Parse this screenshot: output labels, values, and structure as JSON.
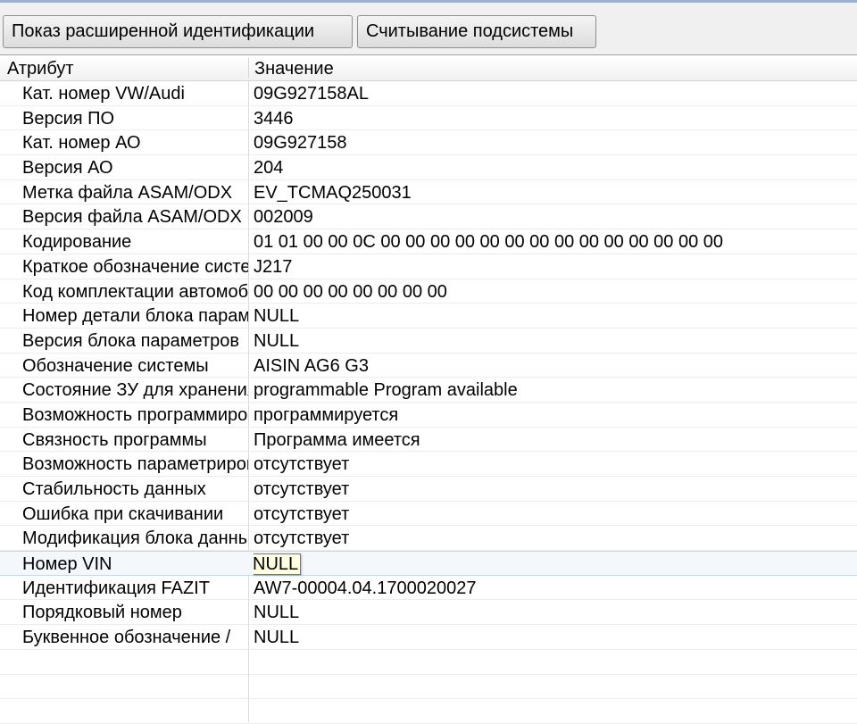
{
  "toolbar": {
    "extended_id_label": "Показ расширенной идентификации",
    "read_subsystem_label": "Считывание подсистемы"
  },
  "table": {
    "columns": [
      "Атрибут",
      "Значение"
    ],
    "rows": [
      {
        "attr": "Кат. номер VW/Audi",
        "value": "09G927158AL"
      },
      {
        "attr": "Версия ПО",
        "value": "3446"
      },
      {
        "attr": "Кат. номер АО",
        "value": "09G927158"
      },
      {
        "attr": "Версия АО",
        "value": "204"
      },
      {
        "attr": "Метка файла ASAM/ODX",
        "value": "EV_TCMAQ250031"
      },
      {
        "attr": "Версия файла ASAM/ODX",
        "value": "002009"
      },
      {
        "attr": "Кодирование",
        "value": "01 01 00 00 0C 00 00 00 00 00 00 00 00 00 00 00 00 00 00"
      },
      {
        "attr": "Краткое обозначение системы",
        "value": "J217"
      },
      {
        "attr": "Код комплектации автомобиля",
        "value": "00 00 00 00 00 00 00 00"
      },
      {
        "attr": "Номер детали блока параметров",
        "value": "NULL"
      },
      {
        "attr": "Версия блока параметров",
        "value": "NULL"
      },
      {
        "attr": "Обозначение системы",
        "value": "AISIN AG6 G3"
      },
      {
        "attr": "Состояние ЗУ для хранения",
        "value": "programmable Program available"
      },
      {
        "attr": "Возможность программирования",
        "value": "программируется"
      },
      {
        "attr": "Связность программы",
        "value": "Программа имеется"
      },
      {
        "attr": "Возможность параметрирования",
        "value": "отсутствует"
      },
      {
        "attr": "Стабильность данных",
        "value": "отсутствует"
      },
      {
        "attr": "Ошибка при скачивании",
        "value": "отсутствует"
      },
      {
        "attr": "Модификация блока данных",
        "value": "отсутствует"
      },
      {
        "attr": "Номер VIN",
        "value": "NULL"
      },
      {
        "attr": "Идентификация FAZIT",
        "value": "AW7-00004.04.1700020027"
      },
      {
        "attr": "Порядковый номер",
        "value": "NULL"
      },
      {
        "attr": "Буквенное обозначение /",
        "value": "NULL"
      }
    ]
  }
}
